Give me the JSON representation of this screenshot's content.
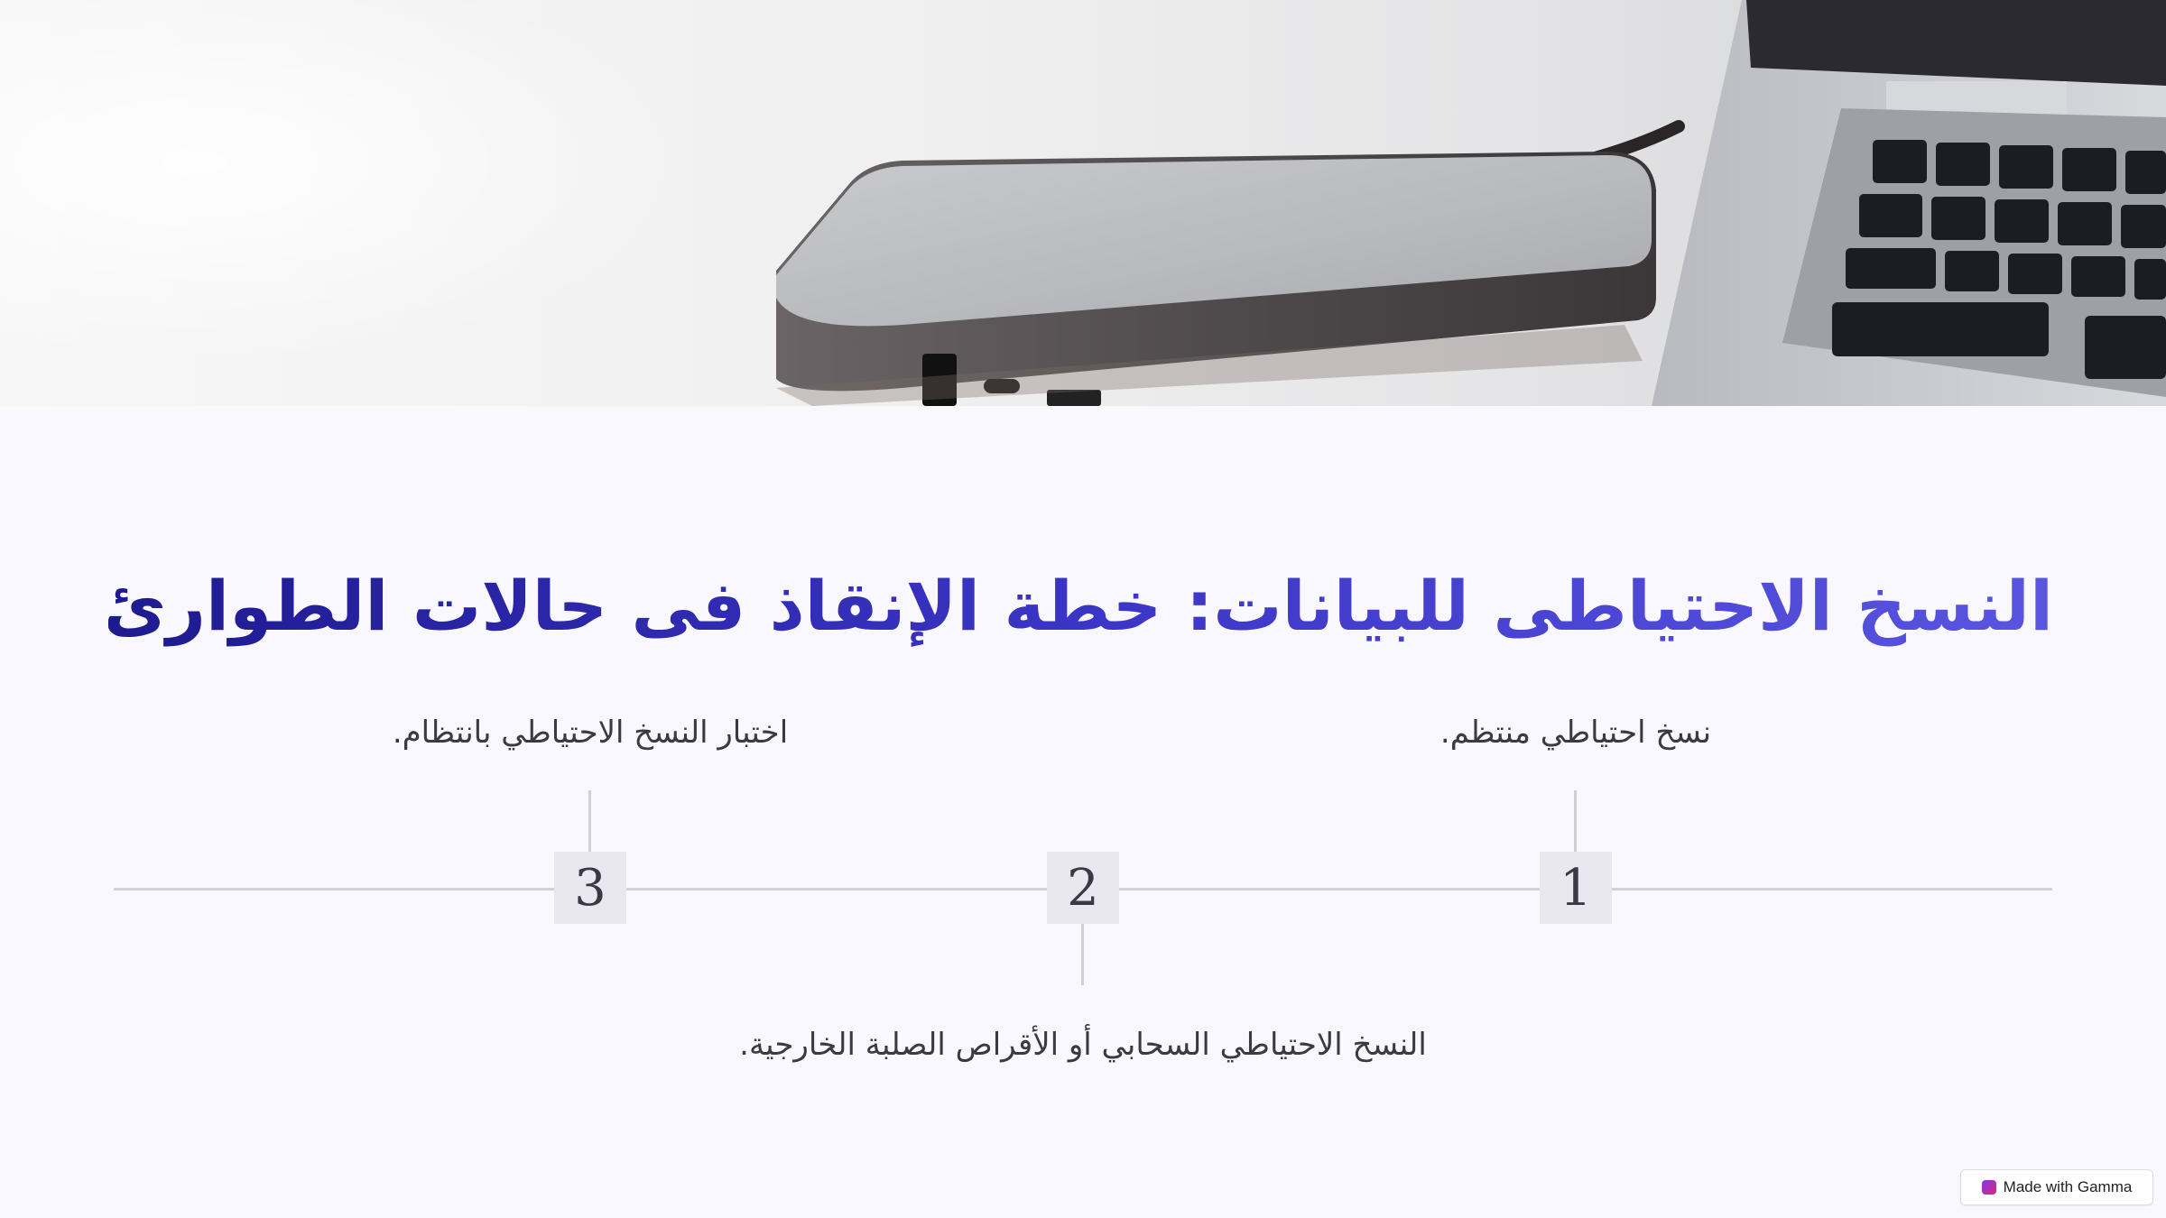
{
  "slide": {
    "title": "النسخ الاحتياطى للبيانات: خطة الإنقاذ فى حالات الطوارئ"
  },
  "timeline": {
    "steps": [
      {
        "number": "1",
        "text": "نسخ احتياطي منتظم."
      },
      {
        "number": "2",
        "text": "النسخ الاحتياطي السحابي أو الأقراص الصلبة الخارجية."
      },
      {
        "number": "3",
        "text": "اختبار النسخ الاحتياطي بانتظام."
      }
    ]
  },
  "badge": {
    "label": "Made with Gamma",
    "icon": "gamma-logo-icon"
  },
  "hero_image": {
    "subject": "external-hard-drive-next-to-laptop"
  }
}
